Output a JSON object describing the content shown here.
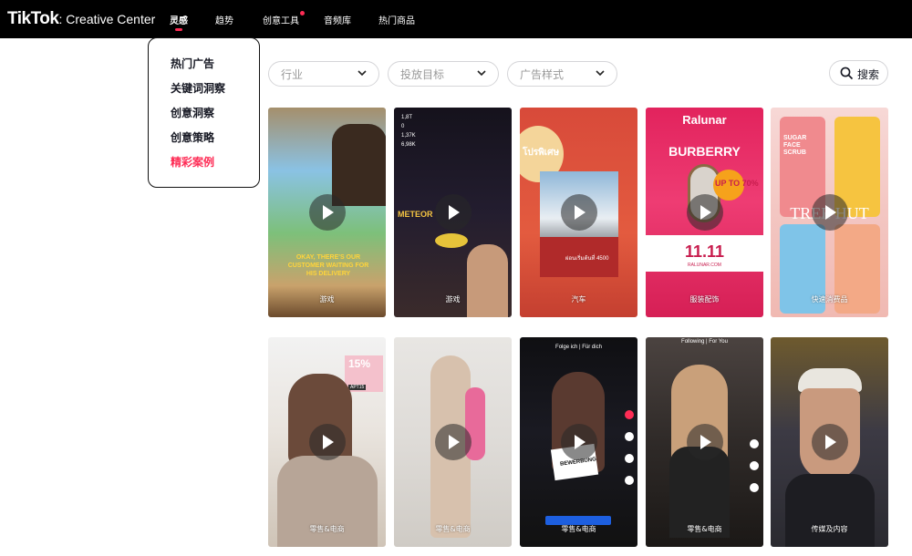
{
  "header": {
    "logo_brand": "TikTok",
    "logo_sub": "Creative Center",
    "nav": [
      {
        "label": "灵感",
        "active": true
      },
      {
        "label": "趋势",
        "active": false
      },
      {
        "label": "创意工具",
        "active": false,
        "badge": true
      },
      {
        "label": "音频库",
        "active": false
      },
      {
        "label": "热门商品",
        "active": false
      }
    ]
  },
  "dropdown": {
    "items": [
      {
        "label": "热门广告"
      },
      {
        "label": "关键词洞察"
      },
      {
        "label": "创意洞察"
      },
      {
        "label": "创意策略"
      },
      {
        "label": "精彩案例",
        "highlighted": true
      }
    ]
  },
  "filters": {
    "industry_placeholder": "行业",
    "objective_placeholder": "投放目标",
    "format_placeholder": "广告样式",
    "search_label": "搜索"
  },
  "cards": [
    {
      "category": "游戏",
      "overlay": "OKAY, THERE'S OUR CUSTOMER WAITING FOR HIS DELIVERY"
    },
    {
      "category": "游戏",
      "overlay": "METEOR",
      "stats": [
        "1,8T",
        "0",
        "1,37K",
        "6,98K"
      ]
    },
    {
      "category": "汽车",
      "overlay": "โปรพิเศษ",
      "price": "ผ่อนเริ่มต้นที่ 4500"
    },
    {
      "category": "服装配饰",
      "brand": "Ralunar",
      "title": "BURBERRY",
      "badge": "UP TO 70%",
      "date": "11.11",
      "url": "RALUNAR.COM"
    },
    {
      "category": "快速消费品",
      "overlay": "SUGAR FACE SCRUB",
      "brand": "TREE HUT"
    },
    {
      "category": "零售&电商",
      "overlay": "15%",
      "code": "APT15"
    },
    {
      "category": "零售&电商"
    },
    {
      "category": "零售&电商",
      "header": "Folge ich | Für dich",
      "overlay": "BEWERBUNG"
    },
    {
      "category": "零售&电商",
      "header": "Following | For You"
    },
    {
      "category": "传媒及内容"
    }
  ],
  "colors": {
    "accent": "#fe2c55",
    "topbar": "#000000"
  }
}
